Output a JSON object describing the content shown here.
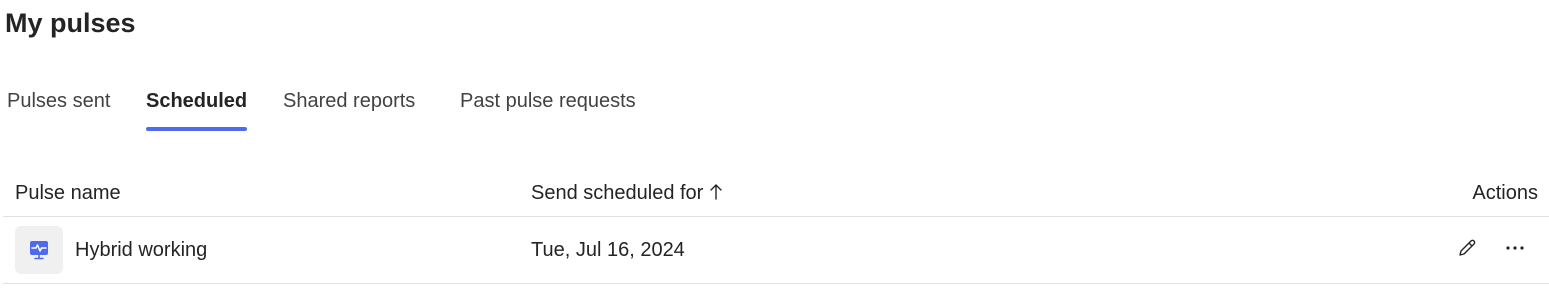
{
  "page": {
    "title": "My pulses"
  },
  "tabs": [
    {
      "label": "Pulses sent",
      "active": false
    },
    {
      "label": "Scheduled",
      "active": true
    },
    {
      "label": "Shared reports",
      "active": false
    },
    {
      "label": "Past pulse requests",
      "active": false
    }
  ],
  "table": {
    "columns": {
      "name": "Pulse name",
      "date": "Send scheduled for",
      "actions": "Actions"
    },
    "sort": {
      "column": "date",
      "direction": "ascending",
      "icon": "arrow-up-icon"
    },
    "rows": [
      {
        "icon": "pulse-monitor-icon",
        "name": "Hybrid working",
        "date": "Tue, Jul 16, 2024",
        "actions": [
          "edit-icon",
          "more-options-icon"
        ]
      }
    ]
  },
  "colors": {
    "accent": "#4f6bed",
    "text": "#242424",
    "divider": "#e0e0e0",
    "icon_tile": "#f0f0f0"
  }
}
